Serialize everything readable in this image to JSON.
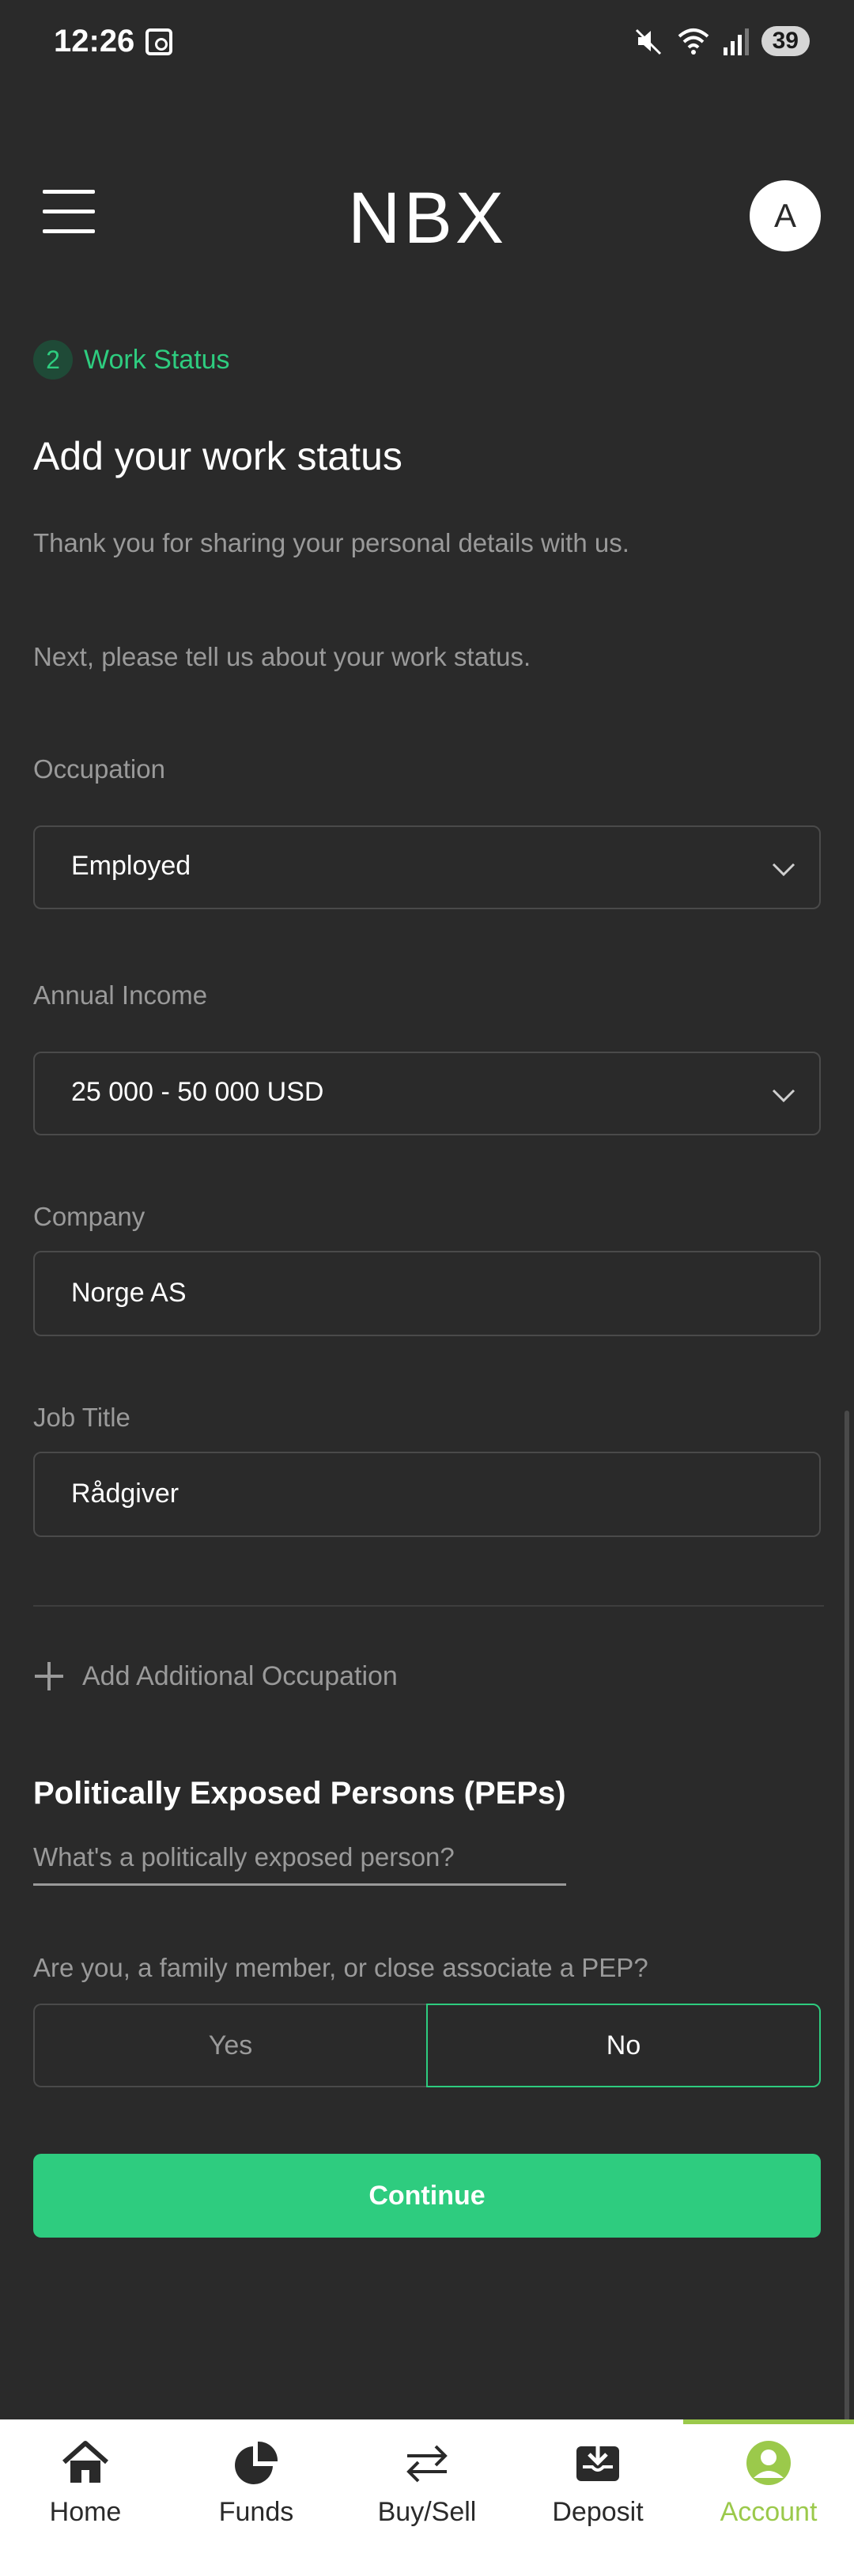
{
  "status_bar": {
    "time": "12:26",
    "battery": "39"
  },
  "header": {
    "logo": "NBX",
    "avatar_letter": "A"
  },
  "step": {
    "number": "2",
    "label": "Work Status"
  },
  "page_title": "Add your work status",
  "intro": {
    "line1": "Thank you for sharing your personal details with us.",
    "line2": "Next, please tell us about your work status."
  },
  "fields": {
    "occupation": {
      "label": "Occupation",
      "value": "Employed"
    },
    "income": {
      "label": "Annual Income",
      "value": "25 000 - 50 000 USD"
    },
    "company": {
      "label": "Company",
      "value": "Norge AS"
    },
    "job_title": {
      "label": "Job Title",
      "value": "Rådgiver"
    }
  },
  "add_occupation_label": "Add Additional Occupation",
  "pep": {
    "title": "Politically Exposed Persons (PEPs)",
    "link": "What's a politically exposed person?",
    "question": "Are you, a family member, or close associate a PEP?",
    "yes_label": "Yes",
    "no_label": "No",
    "selected": "No"
  },
  "continue_label": "Continue",
  "nav": {
    "home": "Home",
    "funds": "Funds",
    "buysell": "Buy/Sell",
    "deposit": "Deposit",
    "account": "Account",
    "active": "Account"
  },
  "colors": {
    "accent": "#2ecc7f",
    "nav_active": "#9bc94b",
    "background": "#2a2a2a"
  }
}
